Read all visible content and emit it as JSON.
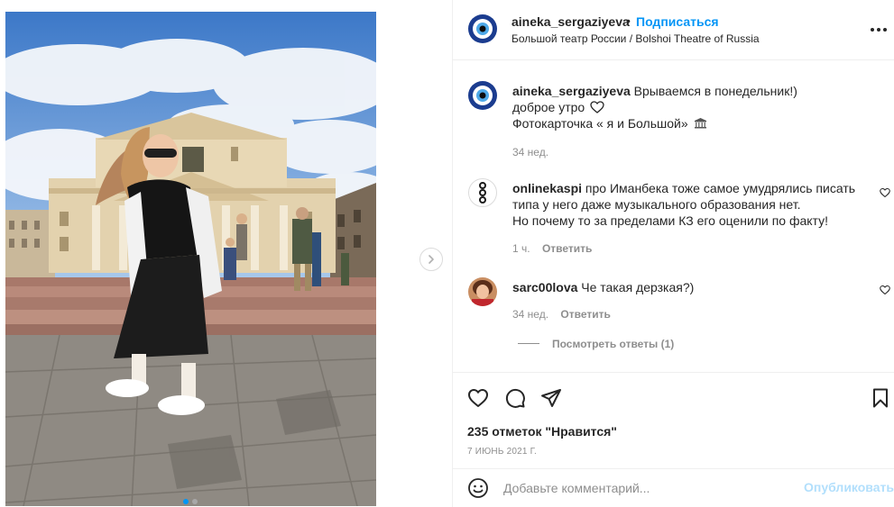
{
  "post": {
    "author": "aineka_sergaziyeva",
    "separator": "•",
    "follow_label": "Подписаться",
    "location": "Большой театр России / Bolshoi Theatre of Russia",
    "more_icon": "more-options-icon",
    "carousel": {
      "slide_count": 2,
      "active_slide": 1,
      "next_icon": "chevron-right-icon"
    }
  },
  "caption": {
    "username": "aineka_sergaziyeva",
    "line1": "Врываемся в понедельник!)",
    "line2": "доброе утро",
    "line2_icon": "heart-outline-icon",
    "line3": "Фотокарточка « я и Большой»",
    "line3_icon": "theatre-building-icon",
    "time": "34 нед."
  },
  "comments": [
    {
      "username": "onlinekaspi",
      "line1": "про Иманбека тоже самое умудрялись писать",
      "line2": "типа у него даже музыкального образования нет.",
      "line3": "Но почему то за пределами КЗ его оценили по факту!",
      "time": "1 ч.",
      "reply_label": "Ответить"
    },
    {
      "username": "sarc00lova",
      "text": "Че такая дерзкая?)",
      "time": "34 нед.",
      "reply_label": "Ответить",
      "view_replies": "Посмотреть ответы (1)"
    }
  ],
  "actions": {
    "icons": [
      "like-heart-icon",
      "comment-bubble-icon",
      "share-paper-plane-icon",
      "save-bookmark-icon"
    ],
    "likes": "235 отметок \"Нравится\"",
    "date": "7 ИЮНЬ 2021 Г."
  },
  "add_comment": {
    "emoji_icon": "emoji-smiley-icon",
    "placeholder": "Добавьте комментарий...",
    "publish_label": "Опубликовать"
  },
  "colors": {
    "accent": "#0095f6",
    "accent_disabled": "#b2dffc",
    "text": "#262626",
    "muted": "#8e8e8e",
    "divider": "#efefef"
  }
}
